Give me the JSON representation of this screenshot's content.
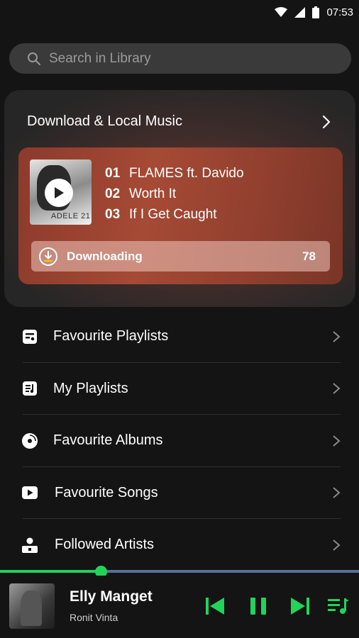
{
  "status_bar": {
    "time": "07:53",
    "icons": [
      "wifi-icon",
      "signal-icon",
      "battery-icon"
    ]
  },
  "search": {
    "placeholder": "Search in Library"
  },
  "download_card": {
    "title": "Download & Local Music",
    "album_cover_text": "ADELE 21",
    "tracks": [
      {
        "number": "01",
        "title": "FLAMES ft. Davido"
      },
      {
        "number": "02",
        "title": "Worth It"
      },
      {
        "number": "03",
        "title": "If I Get Caught"
      }
    ],
    "status_label": "Downloading",
    "count": "78"
  },
  "menu": {
    "items": [
      {
        "label": "Favourite Playlists",
        "icon": "playlist-card-icon"
      },
      {
        "label": "My Playlists",
        "icon": "music-list-icon"
      },
      {
        "label": "Favourite Albums",
        "icon": "album-disc-icon"
      },
      {
        "label": "Favourite Songs",
        "icon": "play-box-icon"
      },
      {
        "label": "Followed Artists",
        "icon": "artist-icon"
      }
    ]
  },
  "player": {
    "title": "Elly Manget",
    "artist": "Ronit Vinta",
    "progress": 0.28,
    "controls": [
      "previous-icon",
      "pause-icon",
      "next-icon",
      "queue-icon"
    ]
  },
  "colors": {
    "accent": "#22d35a",
    "background": "#141414",
    "progress_track": "#5a6f9a"
  }
}
